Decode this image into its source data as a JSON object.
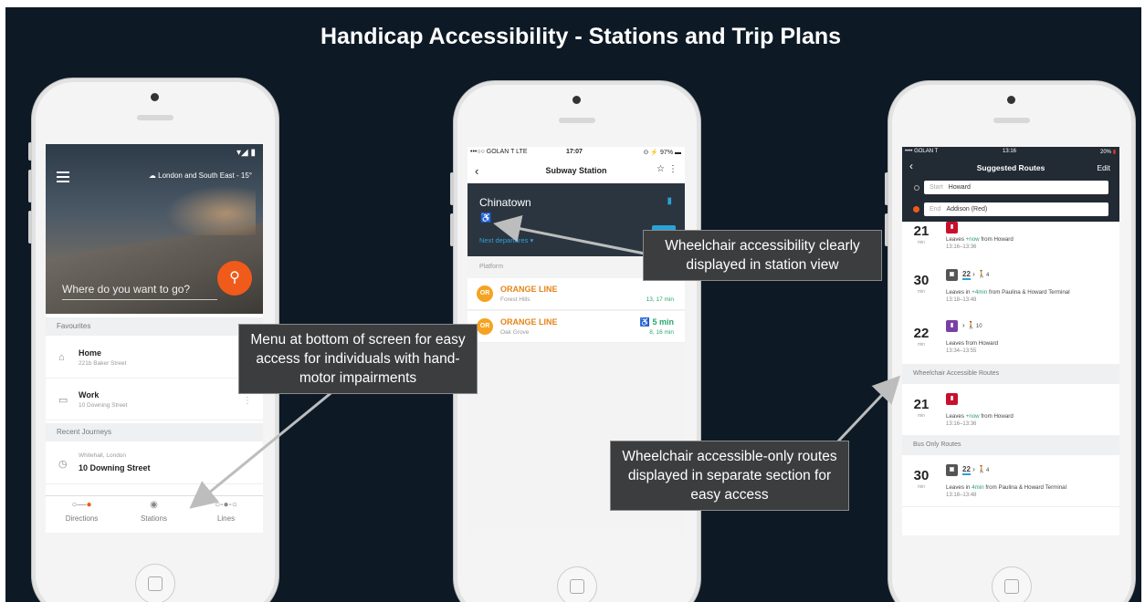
{
  "title": "Handicap Accessibility - Stations and Trip Plans",
  "phone1": {
    "weather": "London and South East - 15°",
    "search_placeholder": "Where do you want to go?",
    "favourites_header": "Favourites",
    "favourites": [
      {
        "title": "Home",
        "subtitle": "221b Baker Street"
      },
      {
        "title": "Work",
        "subtitle": "10 Downing Street"
      }
    ],
    "recent_header": "Recent Journeys",
    "recent": {
      "from": "Whitehall, London",
      "to": "10 Downing Street"
    },
    "tabs": [
      "Directions",
      "Stations",
      "Lines"
    ]
  },
  "phone2": {
    "status_left": "•••○○ GOLAN T  LTE",
    "status_time": "17:07",
    "status_right": "97%",
    "nav_title": "Subway Station",
    "station_name": "Chinatown",
    "next_departures": "Next departures",
    "platform_label": "Platform",
    "lines": [
      {
        "badge": "OR",
        "name": "ORANGE LINE",
        "dest": "Forest Hills",
        "time": "",
        "next": "13, 17 min"
      },
      {
        "badge": "OR",
        "name": "ORANGE LINE",
        "dest": "Oak Grove",
        "time": "5 min",
        "next": "8, 16 min"
      }
    ]
  },
  "phone3": {
    "status_left": "•••• GOLAN T",
    "status_time": "13:16",
    "status_right": "20%",
    "nav_title": "Suggested Routes",
    "edit_label": "Edit",
    "start_label": "Start",
    "start_value": "Howard",
    "end_label": "End",
    "end_value": "Addison (Red)",
    "routes": [
      {
        "num": "21",
        "unit": "min",
        "lead": "Leaves ",
        "highlight": "+now",
        "rest": " from Howard",
        "times": "13:16–13:36"
      },
      {
        "num": "30",
        "unit": "min",
        "bus": "22",
        "walk": "4",
        "lead": "Leaves in ",
        "highlight": "+4min",
        "rest": " from Paulina & Howard Terminal",
        "times": "13:18–13:48"
      },
      {
        "num": "22",
        "unit": "min",
        "walk": "10",
        "lead": "Leaves from Howard",
        "highlight": "",
        "rest": "",
        "times": "13:34–13:55"
      }
    ],
    "wheelchair_header": "Wheelchair Accessible Routes",
    "wheelchair_route": {
      "num": "21",
      "unit": "min",
      "lead": "Leaves ",
      "highlight": "+now",
      "rest": " from Howard",
      "times": "13:16–13:36"
    },
    "bus_header": "Bus Only Routes",
    "bus_route": {
      "num": "30",
      "unit": "min",
      "bus": "22",
      "walk": "4",
      "lead": "Leaves in ",
      "highlight": "4min",
      "rest": " from Paulina & Howard Terminal",
      "times": "13:18–13:48"
    }
  },
  "callouts": {
    "menu": "Menu at bottom of screen for easy access for individuals with hand-motor impairments",
    "station": "Wheelchair accessibility clearly displayed in station view",
    "routes": "Wheelchair accessible-only routes displayed in separate section for easy access"
  },
  "colors": {
    "background": "#0d1a26",
    "accent": "#f05a1a",
    "orange_line": "#f5a321",
    "green": "#2ba06c",
    "red_line": "#c8102e",
    "purple_line": "#7a3fa3",
    "callout_bg": "#3c3d3e"
  }
}
